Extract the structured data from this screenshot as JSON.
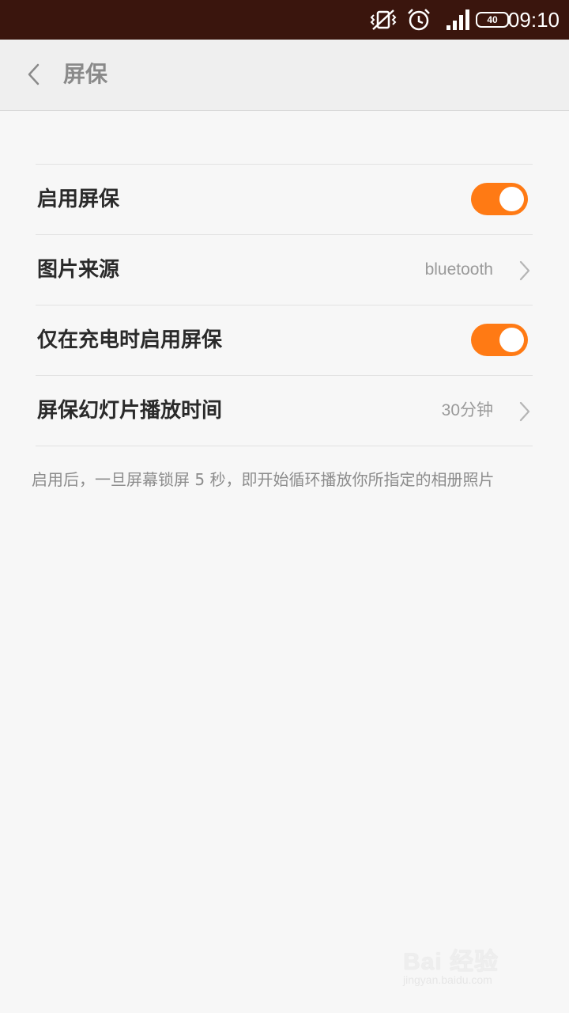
{
  "status_bar": {
    "time": "09:10",
    "battery": "40",
    "icons": [
      "vibrate-off-icon",
      "alarm-icon",
      "signal-icon",
      "battery-icon"
    ]
  },
  "header": {
    "title": "屏保",
    "back_icon": "chevron-left-icon"
  },
  "settings": {
    "items": [
      {
        "label": "启用屏保",
        "type": "toggle",
        "on": true
      },
      {
        "label": "图片来源",
        "type": "link",
        "value": "bluetooth"
      },
      {
        "label": "仅在充电时启用屏保",
        "type": "toggle",
        "on": true
      },
      {
        "label": "屏保幻灯片播放时间",
        "type": "link",
        "value": "30分钟"
      }
    ]
  },
  "hint": "启用后，一旦屏幕锁屏 5 秒，即开始循环播放你所指定的相册照片",
  "colors": {
    "accent": "#ff7a14",
    "status_bar_bg": "#3a150d"
  },
  "watermark": {
    "text": "Bai 经验",
    "subtext": "jingyan.baidu.com"
  }
}
